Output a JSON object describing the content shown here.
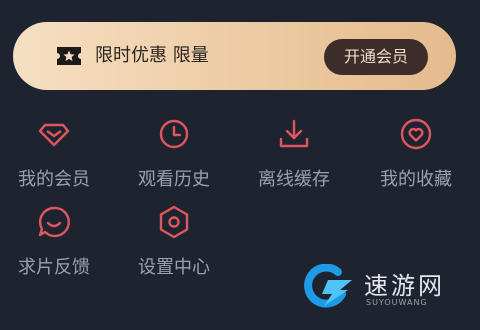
{
  "promo": {
    "text": "限时优惠 限量",
    "button_label": "开通会员",
    "icon": "ticket-star-icon"
  },
  "menu": {
    "items": [
      {
        "label": "我的会员",
        "icon": "diamond-icon"
      },
      {
        "label": "观看历史",
        "icon": "clock-icon"
      },
      {
        "label": "离线缓存",
        "icon": "download-icon"
      },
      {
        "label": "我的收藏",
        "icon": "heart-icon"
      },
      {
        "label": "求片反馈",
        "icon": "smile-chat-icon"
      },
      {
        "label": "设置中心",
        "icon": "hexagon-settings-icon"
      }
    ]
  },
  "watermark": {
    "text_cn": "速游网",
    "text_en": "SUYOUWANG",
    "logo": "g-lightning-logo"
  },
  "colors": {
    "background": "#1e2330",
    "accent": "#e0565f",
    "promo_gradient_start": "#f6dfc2",
    "promo_gradient_end": "#e5bb8e",
    "promo_button": "#3c2c2a"
  }
}
